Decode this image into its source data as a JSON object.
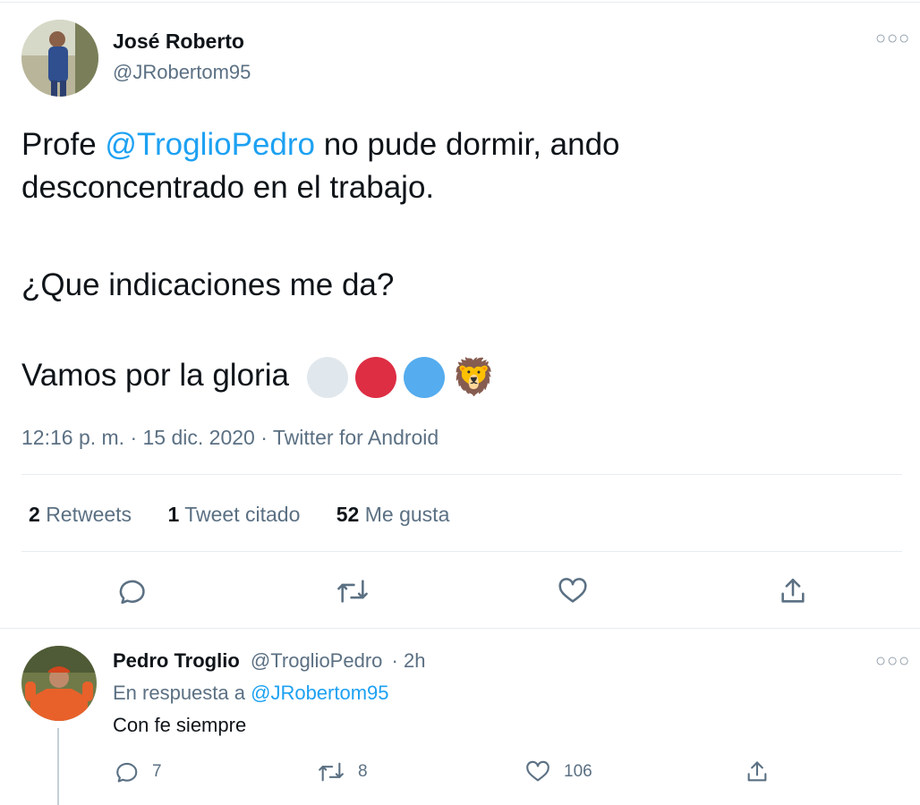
{
  "tweet": {
    "author_name": "José Roberto",
    "author_handle": "@JRobertom95",
    "text_before_mention": "Profe ",
    "mention": "@TroglioPedro",
    "text_after_mention": " no pude dormir, ando",
    "line2": "desconcentrado en el trabajo.",
    "line3": "¿Que indicaciones me da?",
    "line4": "Vamos por la gloria",
    "emoji_colors": [
      "#e1e8ed",
      "#dd2e44",
      "#55acee"
    ],
    "lion_emoji": "🦁",
    "timestamp": "12:16 p. m. · 15 dic. 2020 · Twitter for Android",
    "stats": {
      "retweets_count": "2",
      "retweets_label": "Retweets",
      "quotes_count": "1",
      "quotes_label": "Tweet citado",
      "likes_count": "52",
      "likes_label": "Me gusta"
    },
    "actions": [
      "reply-icon",
      "retweet-icon",
      "like-icon",
      "share-icon"
    ]
  },
  "reply": {
    "author_name": "Pedro Troglio",
    "author_handle": "@TroglioPedro",
    "time": "· 2h",
    "in_reply_prefix": "En respuesta a",
    "in_reply_handle": "@JRobertom95",
    "text": "Con fe siempre",
    "replies_count": "7",
    "retweets_count": "8",
    "likes_count": "106"
  },
  "colors": {
    "link": "#1da1f2",
    "secondary": "#5b7083",
    "divider": "#e6ecf0"
  }
}
